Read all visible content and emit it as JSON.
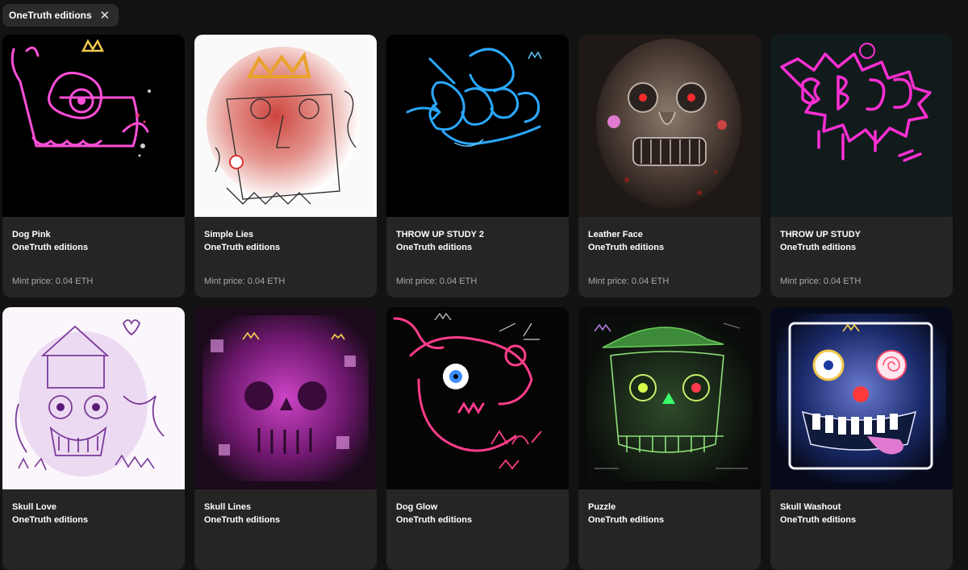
{
  "filter": {
    "chip_label": "OneTruth editions",
    "close_glyph": "✕"
  },
  "cards": [
    {
      "title": "Dog Pink",
      "collection": "OneTruth editions",
      "price": "Mint price: 0.04 ETH",
      "theme": "pink-neon"
    },
    {
      "title": "Simple Lies",
      "collection": "OneTruth editions",
      "price": "Mint price: 0.04 ETH",
      "theme": "white-red-sketch"
    },
    {
      "title": "THROW UP STUDY 2",
      "collection": "OneTruth editions",
      "price": "Mint price: 0.04 ETH",
      "theme": "blue-neon"
    },
    {
      "title": "Leather Face",
      "collection": "OneTruth editions",
      "price": "Mint price: 0.04 ETH",
      "theme": "dark-painted-face"
    },
    {
      "title": "THROW UP STUDY",
      "collection": "OneTruth editions",
      "price": "Mint price: 0.04 ETH",
      "theme": "magenta-graffiti"
    },
    {
      "title": "Skull Love",
      "collection": "OneTruth editions",
      "price": "",
      "theme": "purple-sketch"
    },
    {
      "title": "Skull Lines",
      "collection": "OneTruth editions",
      "price": "",
      "theme": "magenta-skull"
    },
    {
      "title": "Dog Glow",
      "collection": "OneTruth editions",
      "price": "",
      "theme": "pink-glow-dog"
    },
    {
      "title": "Puzzle",
      "collection": "OneTruth editions",
      "price": "",
      "theme": "green-skull"
    },
    {
      "title": "Skull Washout",
      "collection": "OneTruth editions",
      "price": "",
      "theme": "blue-washout"
    }
  ],
  "colors": {
    "page_bg": "#121212",
    "card_bg": "#252525",
    "chip_bg": "#2b2b2b",
    "price_text": "#a8a8a8"
  }
}
